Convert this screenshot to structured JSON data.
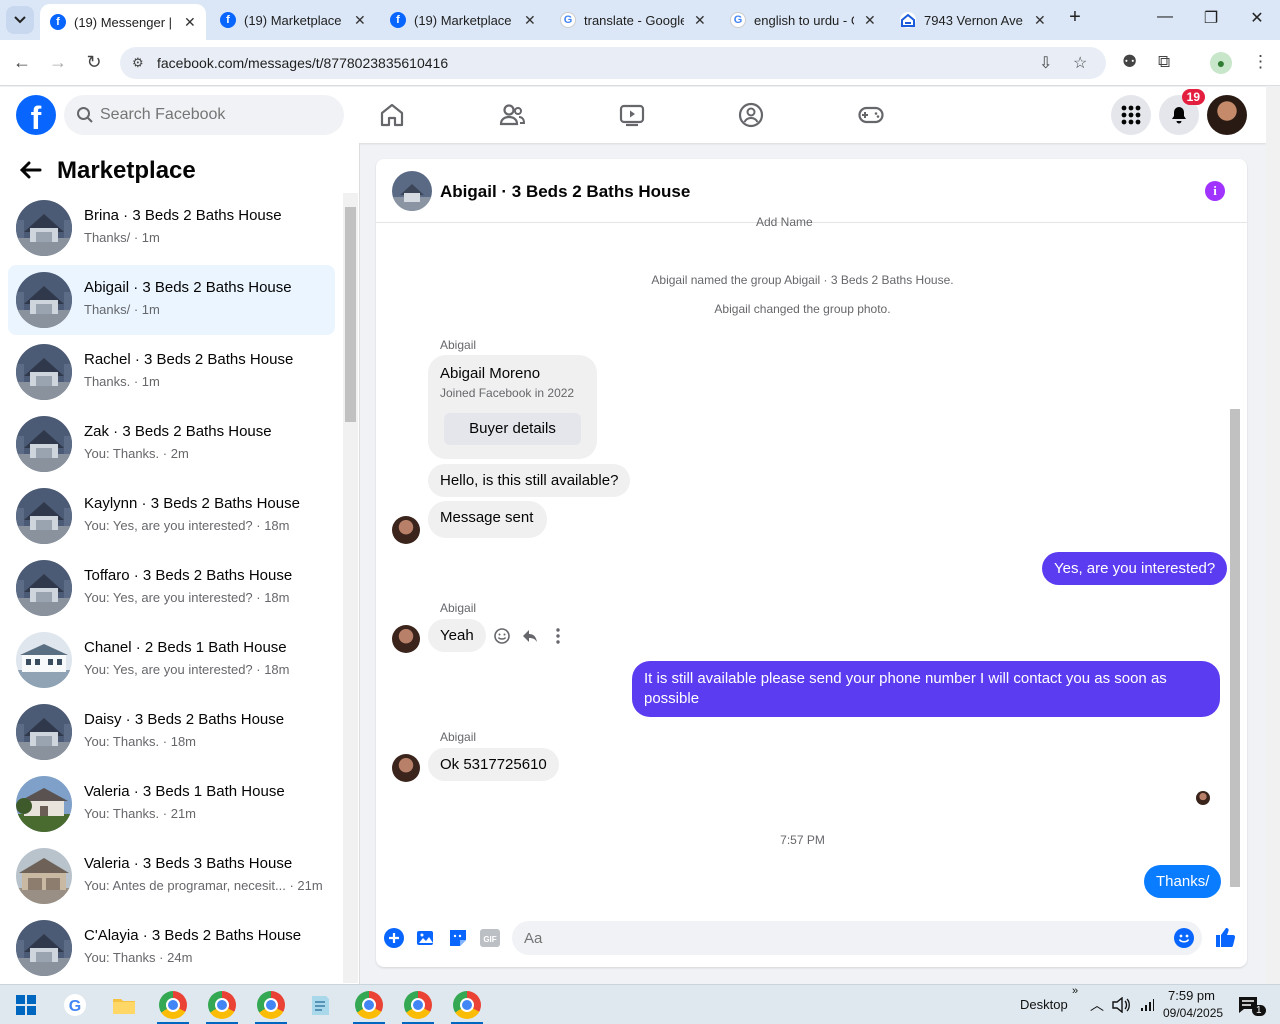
{
  "browser": {
    "tabs": [
      {
        "title": "(19) Messenger | Fa",
        "favicon": "facebook-icon",
        "active": true
      },
      {
        "title": "(19) Marketplace -",
        "favicon": "facebook-icon",
        "active": false
      },
      {
        "title": "(19) Marketplace -",
        "favicon": "facebook-icon",
        "active": false
      },
      {
        "title": "translate - Google",
        "favicon": "google-icon",
        "active": false
      },
      {
        "title": "english to urdu - G",
        "favicon": "google-icon",
        "active": false
      },
      {
        "title": "7943 Vernon Ave,",
        "favicon": "zillow-icon",
        "active": false
      }
    ],
    "url": "facebook.com/messages/t/8778023835610416"
  },
  "fb_header": {
    "search_placeholder": "Search Facebook",
    "notification_count": "19"
  },
  "left_pane": {
    "title": "Marketplace",
    "conversations": [
      {
        "name": "Brina · 3 Beds 2 Baths House",
        "preview": "Thanks/ · 1m",
        "selected": false
      },
      {
        "name": "Abigail · 3 Beds 2 Baths House",
        "preview": "Thanks/ · 1m",
        "selected": true
      },
      {
        "name": "Rachel · 3 Beds 2 Baths House",
        "preview": "Thanks. · 1m",
        "selected": false
      },
      {
        "name": "Zak · 3 Beds 2 Baths House",
        "preview": "You: Thanks. · 2m",
        "selected": false
      },
      {
        "name": "Kaylynn · 3 Beds 2 Baths House",
        "preview": "You: Yes, are you interested? · 18m",
        "selected": false
      },
      {
        "name": "Toffaro · 3 Beds 2 Baths House",
        "preview": "You: Yes, are you interested? · 18m",
        "selected": false
      },
      {
        "name": "Chanel · 2 Beds 1 Bath House",
        "preview": "You: Yes, are you interested? · 18m",
        "selected": false
      },
      {
        "name": "Daisy · 3 Beds 2 Baths House",
        "preview": "You: Thanks. · 18m",
        "selected": false
      },
      {
        "name": "Valeria · 3 Beds 1 Bath House",
        "preview": "You: Thanks. · 21m",
        "selected": false
      },
      {
        "name": "Valeria · 3 Beds 3 Baths House",
        "preview": "You: Antes de programar, necesit... · 21m",
        "selected": false
      },
      {
        "name": "C'Alayia · 3 Beds 2 Baths House",
        "preview": "You: Thanks · 24m",
        "selected": false
      }
    ]
  },
  "chat": {
    "title": "Abigail · 3 Beds 2 Baths House",
    "clipped_top": "Add        Name",
    "system_messages": [
      "Abigail named the group Abigail · 3 Beds 2 Baths House.",
      "Abigail changed the group photo."
    ],
    "sender_name": "Abigail",
    "profile_card": {
      "name": "Abigail Moreno",
      "joined": "Joined Facebook in 2022",
      "button": "Buyer details"
    },
    "messages": [
      {
        "from": "them",
        "text": "Hello, is this still available?"
      },
      {
        "from": "them",
        "text": "Message sent"
      },
      {
        "from": "me",
        "text": "Yes, are you interested?"
      },
      {
        "from": "them",
        "text": "Yeah"
      },
      {
        "from": "me",
        "text": "It is still available please send your phone number I will contact you as soon as possible"
      },
      {
        "from": "them",
        "text": "Ok 5317725610"
      },
      {
        "from": "me",
        "text": "Thanks/"
      }
    ],
    "timestamp": "7:57 PM",
    "composer_placeholder": "Aa"
  },
  "taskbar": {
    "desktop_label": "Desktop",
    "time": "7:59 pm",
    "date": "09/04/2025",
    "notification_count": "1"
  },
  "colors": {
    "fb_blue": "#0866ff",
    "outgoing_bubble": "#5b3cf0",
    "selected_row": "#ebf5ff",
    "info_purple": "#a033ff"
  }
}
